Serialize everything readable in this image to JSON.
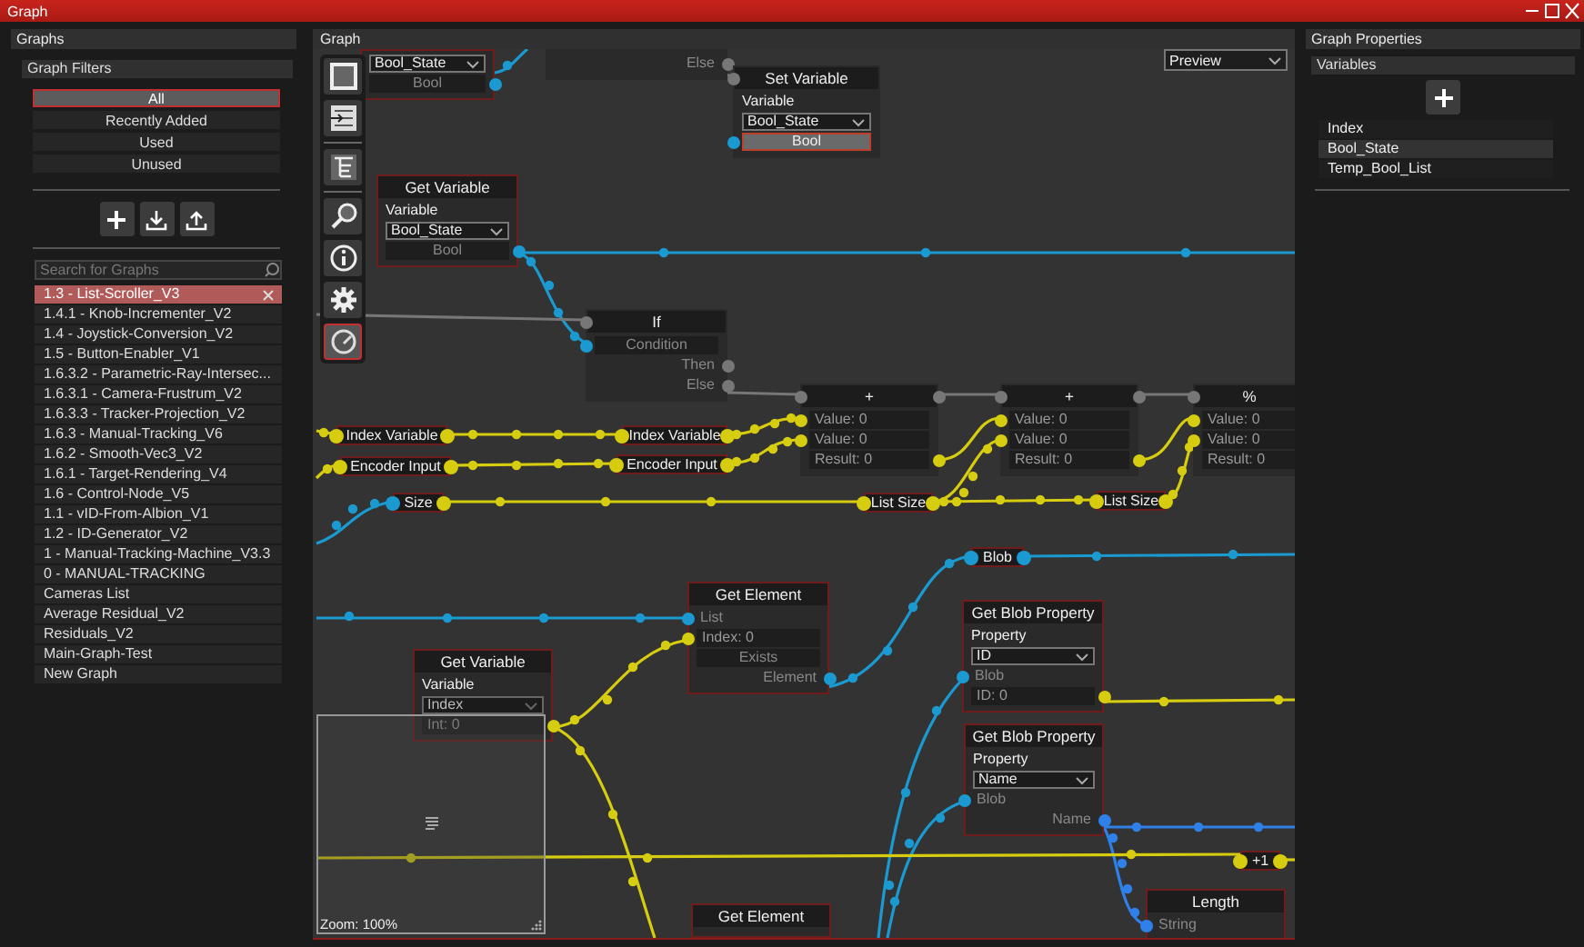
{
  "window": {
    "title": "Graph"
  },
  "graphs_panel": {
    "title": "Graphs",
    "filters_title": "Graph Filters",
    "filters": [
      {
        "label": "All",
        "selected": true
      },
      {
        "label": "Recently Added",
        "selected": false
      },
      {
        "label": "Used",
        "selected": false
      },
      {
        "label": "Unused",
        "selected": false
      }
    ],
    "search": {
      "placeholder": "Search for Graphs"
    },
    "graphs": [
      {
        "label": "1.3 - List-Scroller_V3",
        "selected": true
      },
      {
        "label": "1.4.1 - Knob-Incrementer_V2",
        "selected": false
      },
      {
        "label": "1.4 - Joystick-Conversion_V2",
        "selected": false
      },
      {
        "label": "1.5 - Button-Enabler_V1",
        "selected": false
      },
      {
        "label": "1.6.3.2 - Parametric-Ray-Intersec...",
        "selected": false
      },
      {
        "label": "1.6.3.1 - Camera-Frustrum_V2",
        "selected": false
      },
      {
        "label": "1.6.3.3 - Tracker-Projection_V2",
        "selected": false
      },
      {
        "label": "1.6.3 - Manual-Tracking_V6",
        "selected": false
      },
      {
        "label": "1.6.2 - Smooth-Vec3_V2",
        "selected": false
      },
      {
        "label": "1.6.1 - Target-Rendering_V4",
        "selected": false
      },
      {
        "label": "1.6 - Control-Node_V5",
        "selected": false
      },
      {
        "label": "1.1 - vID-From-Albion_V1",
        "selected": false
      },
      {
        "label": "1.2 - ID-Generator_V2",
        "selected": false
      },
      {
        "label": "1 - Manual-Tracking-Machine_V3.3",
        "selected": false
      },
      {
        "label": "0 - MANUAL-TRACKING",
        "selected": false
      },
      {
        "label": "Cameras List",
        "selected": false
      },
      {
        "label": "Average Residual_V2",
        "selected": false
      },
      {
        "label": "Residuals_V2",
        "selected": false
      },
      {
        "label": "Main-Graph-Test",
        "selected": false
      },
      {
        "label": "New Graph",
        "selected": false
      }
    ]
  },
  "graph": {
    "title": "Graph",
    "view_select": {
      "value": "Preview"
    },
    "tools": [
      {
        "kind": "frame",
        "selected": false
      },
      {
        "kind": "list",
        "selected": false
      },
      {
        "kind": "tree",
        "selected": false
      },
      {
        "kind": "search",
        "selected": false
      },
      {
        "kind": "info",
        "selected": false
      },
      {
        "kind": "settings",
        "selected": false
      },
      {
        "kind": "gauge",
        "selected": true
      }
    ],
    "nodes": [
      {
        "kind": "node",
        "selected": true,
        "rows": [
          {
            "kind": "dropdown",
            "text": "Bool_State"
          },
          {
            "kind": "output",
            "text": "Bool",
            "out_port": {
              "color": "#1a9ad0"
            }
          }
        ]
      },
      {
        "kind": "node",
        "selected": false,
        "rows": [
          {
            "kind": "out",
            "text": "Else",
            "out_port": {
              "color": "#777777"
            }
          }
        ]
      },
      {
        "kind": "node",
        "title": "Set Variable",
        "selected": false,
        "flow_in": true,
        "rows": [
          {
            "kind": "label",
            "text": "Variable"
          },
          {
            "kind": "dropdown",
            "text": "Bool_State"
          },
          {
            "kind": "button",
            "text": "Bool",
            "in_port": {
              "color": "#1a9ad0"
            }
          }
        ]
      },
      {
        "kind": "node",
        "title": "Get Variable",
        "selected": true,
        "rows": [
          {
            "kind": "label",
            "text": "Variable"
          },
          {
            "kind": "dropdown",
            "text": "Bool_State"
          },
          {
            "kind": "output",
            "text": "Bool",
            "out_port": {
              "color": "#1a9ad0"
            }
          }
        ]
      },
      {
        "kind": "node",
        "title": "If",
        "selected": false,
        "flow_in": true,
        "rows": [
          {
            "kind": "output",
            "text": "Condition",
            "in_port": {
              "color": "#1a9ad0"
            }
          },
          {
            "kind": "out",
            "text": "Then",
            "out_port": {
              "color": "#777777"
            }
          },
          {
            "kind": "out",
            "text": "Else",
            "out_port": {
              "color": "#777777"
            }
          }
        ]
      },
      {
        "kind": "node",
        "title": "+",
        "selected": false,
        "flow_in": true,
        "flow_out": true,
        "rows": [
          {
            "kind": "value",
            "text": "Value: 0",
            "in_port": {
              "color": "#d6cc10"
            }
          },
          {
            "kind": "value",
            "text": "Value: 0",
            "in_port": {
              "color": "#d6cc10"
            }
          },
          {
            "kind": "value",
            "text": "Result: 0",
            "out_port": {
              "color": "#d6cc10"
            }
          }
        ]
      },
      {
        "kind": "node",
        "title": "+",
        "selected": false,
        "flow_in": true,
        "flow_out": true,
        "rows": [
          {
            "kind": "value",
            "text": "Value: 0",
            "in_port": {
              "color": "#d6cc10"
            }
          },
          {
            "kind": "value",
            "text": "Value: 0",
            "in_port": {
              "color": "#d6cc10"
            }
          },
          {
            "kind": "value",
            "text": "Result: 0",
            "out_port": {
              "color": "#d6cc10"
            }
          }
        ]
      },
      {
        "kind": "node",
        "title": "%",
        "selected": false,
        "flow_in": true,
        "rows": [
          {
            "kind": "value",
            "text": "Value: 0",
            "in_port": {
              "color": "#d6cc10"
            }
          },
          {
            "kind": "value",
            "text": "Value: 0",
            "in_port": {
              "color": "#d6cc10"
            }
          },
          {
            "kind": "value",
            "text": "Result: 0"
          }
        ]
      },
      {
        "kind": "pill",
        "text": "Index Variable",
        "selected": true,
        "in_port": {
          "color": "#d6cc10"
        },
        "out_port": {
          "color": "#d6cc10"
        }
      },
      {
        "kind": "pill",
        "text": "Index Variable",
        "selected": true,
        "in_port": {
          "color": "#d6cc10"
        },
        "out_port": {
          "color": "#d6cc10"
        }
      },
      {
        "kind": "pill",
        "text": "Encoder Input",
        "selected": true,
        "in_port": {
          "color": "#d6cc10"
        },
        "out_port": {
          "color": "#d6cc10"
        }
      },
      {
        "kind": "pill",
        "text": "Encoder Input",
        "selected": true,
        "in_port": {
          "color": "#d6cc10"
        },
        "out_port": {
          "color": "#d6cc10"
        }
      },
      {
        "kind": "pill",
        "text": "Size",
        "selected": true,
        "in_port": {
          "color": "#1a9ad0"
        },
        "out_port": {
          "color": "#d6cc10"
        }
      },
      {
        "kind": "pill",
        "text": "List Size",
        "selected": true,
        "in_port": {
          "color": "#d6cc10"
        },
        "out_port": {
          "color": "#d6cc10"
        }
      },
      {
        "kind": "pill",
        "text": "List Size",
        "selected": true,
        "in_port": {
          "color": "#d6cc10"
        },
        "out_port": {
          "color": "#d6cc10"
        }
      },
      {
        "kind": "pill",
        "text": "Blob",
        "selected": true,
        "in_port": {
          "color": "#1a9ad0"
        },
        "out_port": {
          "color": "#1a9ad0"
        }
      },
      {
        "kind": "node",
        "title": "Get Element",
        "selected": true,
        "rows": [
          {
            "kind": "in",
            "text": "List",
            "in_port": {
              "color": "#1a9ad0"
            }
          },
          {
            "kind": "value",
            "text": "Index: 0",
            "in_port": {
              "color": "#d6cc10"
            }
          },
          {
            "kind": "output",
            "text": "Exists"
          },
          {
            "kind": "out",
            "text": "Element",
            "out_port": {
              "color": "#1a9ad0"
            }
          }
        ]
      },
      {
        "kind": "node",
        "title": "Get Blob Property",
        "selected": true,
        "rows": [
          {
            "kind": "label",
            "text": "Property"
          },
          {
            "kind": "dropdown",
            "text": "ID"
          },
          {
            "kind": "in",
            "text": "Blob",
            "in_port": {
              "color": "#1a9ad0"
            }
          },
          {
            "kind": "value",
            "text": "ID: 0",
            "out_port": {
              "color": "#d6cc10"
            }
          }
        ]
      },
      {
        "kind": "node",
        "title": "Get Variable",
        "selected": true,
        "rows": [
          {
            "kind": "label",
            "text": "Variable"
          },
          {
            "kind": "dropdown",
            "text": "Index",
            "disabled": true
          },
          {
            "kind": "value",
            "text": "Int: 0",
            "out_port": {
              "color": "#d6cc10"
            }
          }
        ]
      },
      {
        "kind": "node",
        "title": "Get Blob Property",
        "selected": true,
        "rows": [
          {
            "kind": "label",
            "text": "Property"
          },
          {
            "kind": "dropdown",
            "text": "Name"
          },
          {
            "kind": "in",
            "text": "Blob",
            "in_port": {
              "color": "#1a9ad0"
            }
          },
          {
            "kind": "out",
            "text": "Name",
            "out_port": {
              "color": "#2f80e8"
            }
          }
        ]
      },
      {
        "kind": "pill",
        "text": "+1",
        "selected": true,
        "in_port": {
          "color": "#d6cc10"
        },
        "out_port": {
          "color": "#d6cc10"
        }
      },
      {
        "kind": "node",
        "title": "Get Element",
        "selected": true
      },
      {
        "kind": "node",
        "title": "Length",
        "selected": true,
        "rows": [
          {
            "kind": "in",
            "text": "String",
            "in_port": {
              "color": "#2f80e8"
            }
          }
        ]
      }
    ],
    "minimap": {
      "zoom": "Zoom: 100%"
    }
  },
  "properties": {
    "title": "Graph Properties",
    "variables_title": "Variables",
    "variables": [
      {
        "label": "Index",
        "selected": false
      },
      {
        "label": "Bool_State",
        "selected": true
      },
      {
        "label": "Temp_Bool_List",
        "selected": false
      }
    ]
  }
}
